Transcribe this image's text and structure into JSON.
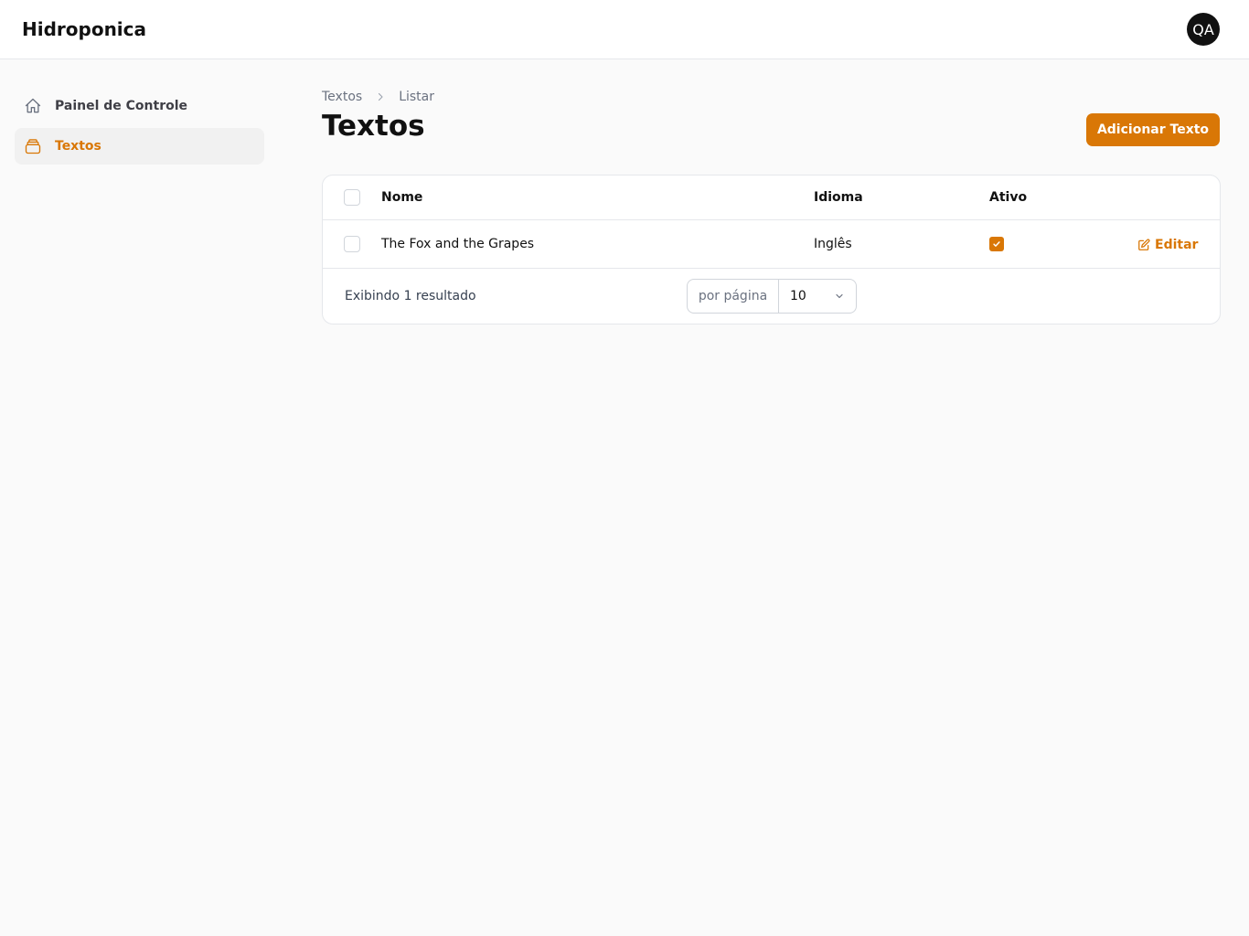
{
  "app": {
    "brand": "Hidroponica",
    "user_initials": "QA"
  },
  "colors": {
    "accent": "#d97706",
    "background": "#fafafa",
    "border": "#e5e7eb"
  },
  "sidebar": {
    "items": [
      {
        "label": "Painel de Controle",
        "icon": "home-icon",
        "active": false
      },
      {
        "label": "Textos",
        "icon": "stack-icon",
        "active": true
      }
    ]
  },
  "breadcrumb": {
    "items": [
      "Textos",
      "Listar"
    ],
    "separator_icon": "chevron-right-icon"
  },
  "page": {
    "title": "Textos",
    "add_button": "Adicionar Texto"
  },
  "table": {
    "columns": [
      "Nome",
      "Idioma",
      "Ativo"
    ],
    "rows": [
      {
        "nome": "The Fox and the Grapes",
        "idioma": "Inglês",
        "ativo": true,
        "action": "Editar"
      }
    ],
    "footer": {
      "summary": "Exibindo 1 resultado",
      "per_page_label": "por página",
      "per_page_value": "10"
    }
  }
}
